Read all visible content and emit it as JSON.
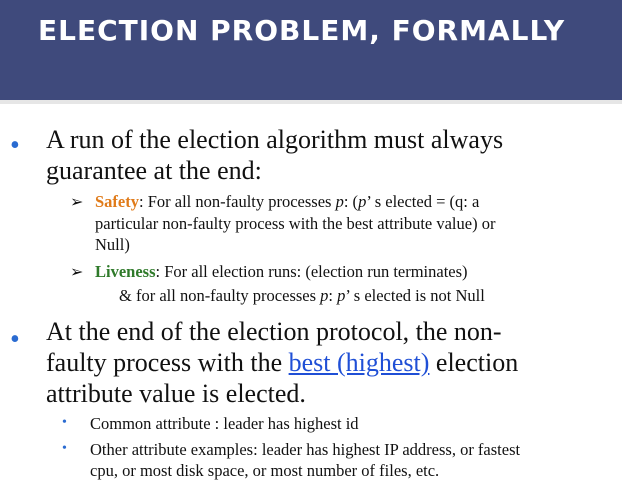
{
  "title": "Election Problem, Formally",
  "bullet1": {
    "line1": "A run of the election algorithm must always",
    "line2": "guarantee at the end:"
  },
  "safety": {
    "keyword": "Safety",
    "colon": ":",
    "text_a": "  For all non-faulty processes ",
    "p1": "p",
    "text_b": ": (",
    "p2": "p",
    "text_c": "’ s elected = (q: a",
    "line2": "particular non-faulty process with the best attribute value) or",
    "line3": "Null)"
  },
  "liveness": {
    "keyword": "Liveness",
    "text_a": ": For all election runs: (election run terminates)",
    "line2_a": "& for all non-faulty processes ",
    "p1": "p",
    "line2_b": ": ",
    "p2": "p",
    "line2_c": "’ s elected is not Null"
  },
  "bullet2": {
    "line1": "At the end of the election protocol, the non-",
    "line2_a": "faulty process with the ",
    "link": "best (highest)",
    "line2_b": " election",
    "line3": "attribute value is elected."
  },
  "sub1": {
    "text": "Common attribute : leader has highest id"
  },
  "sub2": {
    "line1": "Other attribute examples: leader has highest IP address, or fastest",
    "line2": "cpu, or most disk space, or most number of files, etc."
  },
  "icons": {
    "bullet": "•",
    "arrow": "➢"
  },
  "colors": {
    "title_bar": "#3f4a7c",
    "bullet": "#2a6bd1",
    "safety": "#e07b1a",
    "liveness": "#2f7a2a",
    "link": "#1f4fd6"
  }
}
